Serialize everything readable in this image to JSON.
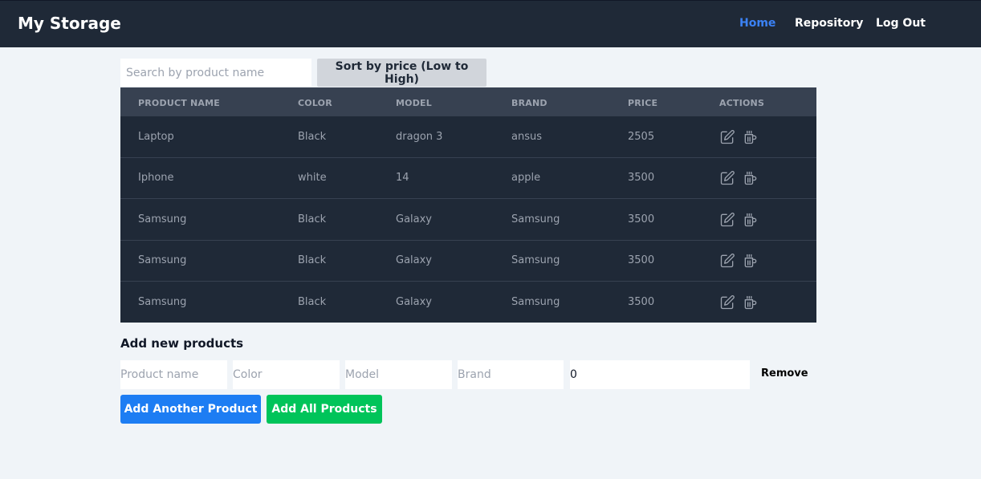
{
  "nav": {
    "brand": "My Storage",
    "links": [
      {
        "label": "Home",
        "active": true
      },
      {
        "label": "Repository",
        "active": false
      },
      {
        "label": "Log Out",
        "active": false
      }
    ]
  },
  "toolbar": {
    "search_placeholder": "Search by product name",
    "search_value": "",
    "sort_label": "Sort by price (Low to High)"
  },
  "table": {
    "columns": [
      "PRODUCT NAME",
      "COLOR",
      "MODEL",
      "BRAND",
      "PRICE",
      "ACTIONS"
    ],
    "rows": [
      {
        "name": "Laptop",
        "color": "Black",
        "model": "dragon 3",
        "brand": "ansus",
        "price": "2505"
      },
      {
        "name": "Iphone",
        "color": "white",
        "model": "14",
        "brand": "apple",
        "price": "3500"
      },
      {
        "name": "Samsung",
        "color": "Black",
        "model": "Galaxy",
        "brand": "Samsung",
        "price": "3500"
      },
      {
        "name": "Samsung",
        "color": "Black",
        "model": "Galaxy",
        "brand": "Samsung",
        "price": "3500"
      },
      {
        "name": "Samsung",
        "color": "Black",
        "model": "Galaxy",
        "brand": "Samsung",
        "price": "3500"
      }
    ],
    "row_icons": [
      "edit-icon",
      "delete-icon"
    ]
  },
  "add_form": {
    "title": "Add new products",
    "placeholders": {
      "name": "Product name",
      "color": "Color",
      "model": "Model",
      "brand": "Brand"
    },
    "price_value": "0",
    "remove_label": "Remove",
    "add_another_label": "Add Another Product",
    "add_all_label": "Add All Products"
  },
  "colors": {
    "navbar": "#1f2937",
    "accent_blue": "#1d7df3",
    "accent_green": "#00c45a",
    "active_link": "#3b82f6"
  }
}
